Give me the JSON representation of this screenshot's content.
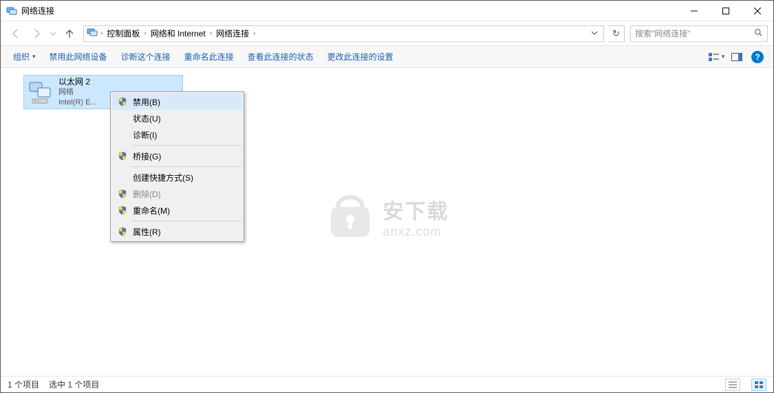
{
  "window": {
    "title": "网络连接"
  },
  "breadcrumbs": {
    "items": [
      "控制面板",
      "网络和 Internet",
      "网络连接"
    ]
  },
  "search": {
    "placeholder": "搜索\"网络连接\""
  },
  "toolbar": {
    "organize": "组织",
    "disable": "禁用此网络设备",
    "diagnose": "诊断这个连接",
    "rename": "重命名此连接",
    "status": "查看此连接的状态",
    "change": "更改此连接的设置"
  },
  "connection": {
    "name": "以太网 2",
    "network": "网络",
    "adapter": "Intel(R) E..."
  },
  "context_menu": {
    "items": [
      {
        "label": "禁用(B)",
        "shield": true,
        "enabled": true,
        "highlighted": true
      },
      {
        "label": "状态(U)",
        "shield": false,
        "enabled": true
      },
      {
        "label": "诊断(I)",
        "shield": false,
        "enabled": true
      },
      {
        "sep": true
      },
      {
        "label": "桥接(G)",
        "shield": true,
        "enabled": true
      },
      {
        "sep": true
      },
      {
        "label": "创建快捷方式(S)",
        "shield": false,
        "enabled": true
      },
      {
        "label": "删除(D)",
        "shield": true,
        "enabled": false
      },
      {
        "label": "重命名(M)",
        "shield": true,
        "enabled": true
      },
      {
        "sep": true
      },
      {
        "label": "属性(R)",
        "shield": true,
        "enabled": true
      }
    ]
  },
  "status": {
    "count": "1 个项目",
    "selected": "选中 1 个项目"
  },
  "watermark": {
    "cn": "安下载",
    "en": "anxz.com"
  }
}
